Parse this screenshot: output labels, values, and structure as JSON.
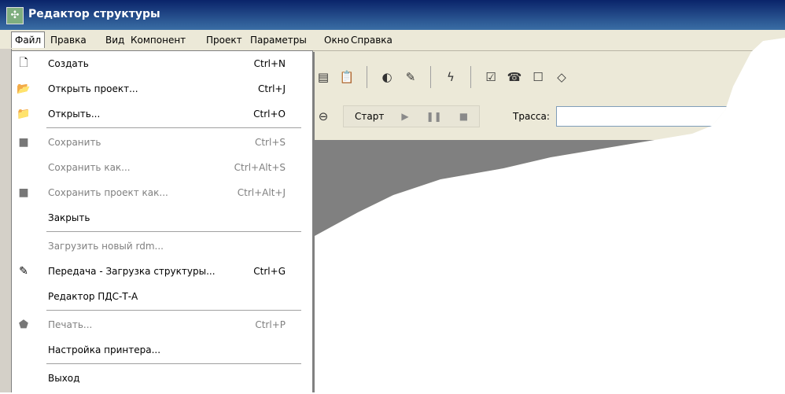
{
  "window": {
    "title": "Редактор структуры"
  },
  "menubar": {
    "items": [
      "Файл",
      "Правка",
      "Вид",
      "Компонент",
      "Проект",
      "Параметры",
      "Окно",
      "Справка"
    ]
  },
  "file_menu": {
    "items": [
      {
        "label": "Создать",
        "shortcut": "Ctrl+N",
        "enabled": true,
        "icon": "new-file-icon"
      },
      {
        "label": "Открыть проект...",
        "shortcut": "Ctrl+J",
        "enabled": true,
        "icon": "open-project-icon"
      },
      {
        "label": "Открыть...",
        "shortcut": "Ctrl+O",
        "enabled": true,
        "icon": "open-folder-icon"
      },
      {
        "label": "Сохранить",
        "shortcut": "Ctrl+S",
        "enabled": false,
        "icon": "save-icon"
      },
      {
        "label": "Сохранить как...",
        "shortcut": "Ctrl+Alt+S",
        "enabled": false,
        "icon": ""
      },
      {
        "label": "Сохранить проект как...",
        "shortcut": "Ctrl+Alt+J",
        "enabled": false,
        "icon": "save-project-icon"
      },
      {
        "label": "Закрыть",
        "shortcut": "",
        "enabled": true,
        "icon": ""
      },
      {
        "label": "Загрузить новый rdm...",
        "shortcut": "",
        "enabled": false,
        "icon": ""
      },
      {
        "label": "Передача - Загрузка структуры...",
        "shortcut": "Ctrl+G",
        "enabled": true,
        "icon": "transfer-icon"
      },
      {
        "label": "Редактор ПДС-Т-А",
        "shortcut": "",
        "enabled": true,
        "icon": ""
      },
      {
        "label": "Печать...",
        "shortcut": "Ctrl+P",
        "enabled": false,
        "icon": "print-icon"
      },
      {
        "label": "Настройка принтера...",
        "shortcut": "",
        "enabled": true,
        "icon": ""
      },
      {
        "label": "Выход",
        "shortcut": "",
        "enabled": true,
        "icon": ""
      }
    ]
  },
  "runbar": {
    "start_label": "Старт",
    "trace_label": "Трасса:",
    "trace_value": ""
  }
}
